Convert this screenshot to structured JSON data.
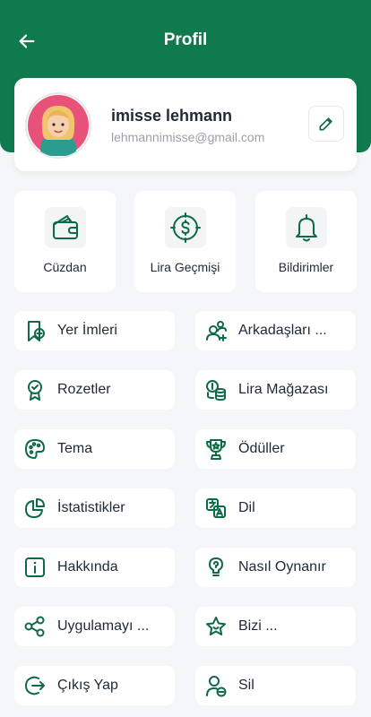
{
  "header": {
    "title": "Profil"
  },
  "profile": {
    "name": "imisse lehmann",
    "email": "lehmannimisse@gmail.com"
  },
  "quick_actions": [
    {
      "label": "Cüzdan",
      "icon": "wallet-icon"
    },
    {
      "label": "Lira Geçmişi",
      "icon": "dollar-compass-icon"
    },
    {
      "label": "Bildirimler",
      "icon": "bell-icon"
    }
  ],
  "menu": [
    {
      "label": "Yer İmleri",
      "icon": "bookmark-add-icon"
    },
    {
      "label": "Arkadaşları ...",
      "icon": "add-friend-icon"
    },
    {
      "label": "Rozetler",
      "icon": "badge-icon"
    },
    {
      "label": "Lira Mağazası",
      "icon": "coins-icon"
    },
    {
      "label": "Tema",
      "icon": "palette-icon"
    },
    {
      "label": "Ödüller",
      "icon": "trophy-icon"
    },
    {
      "label": "İstatistikler",
      "icon": "pie-chart-icon"
    },
    {
      "label": "Dil",
      "icon": "translate-icon"
    },
    {
      "label": "Hakkında",
      "icon": "info-icon"
    },
    {
      "label": "Nasıl Oynanır",
      "icon": "help-icon"
    },
    {
      "label": "Uygulamayı ...",
      "icon": "share-icon"
    },
    {
      "label": "Bizi ...",
      "icon": "star-icon"
    },
    {
      "label": "Çıkış Yap",
      "icon": "logout-icon"
    },
    {
      "label": "Sil",
      "icon": "delete-user-icon"
    }
  ],
  "colors": {
    "brand": "#0e7a4e",
    "icon": "#0e6a45",
    "background": "#f4f6f9"
  }
}
